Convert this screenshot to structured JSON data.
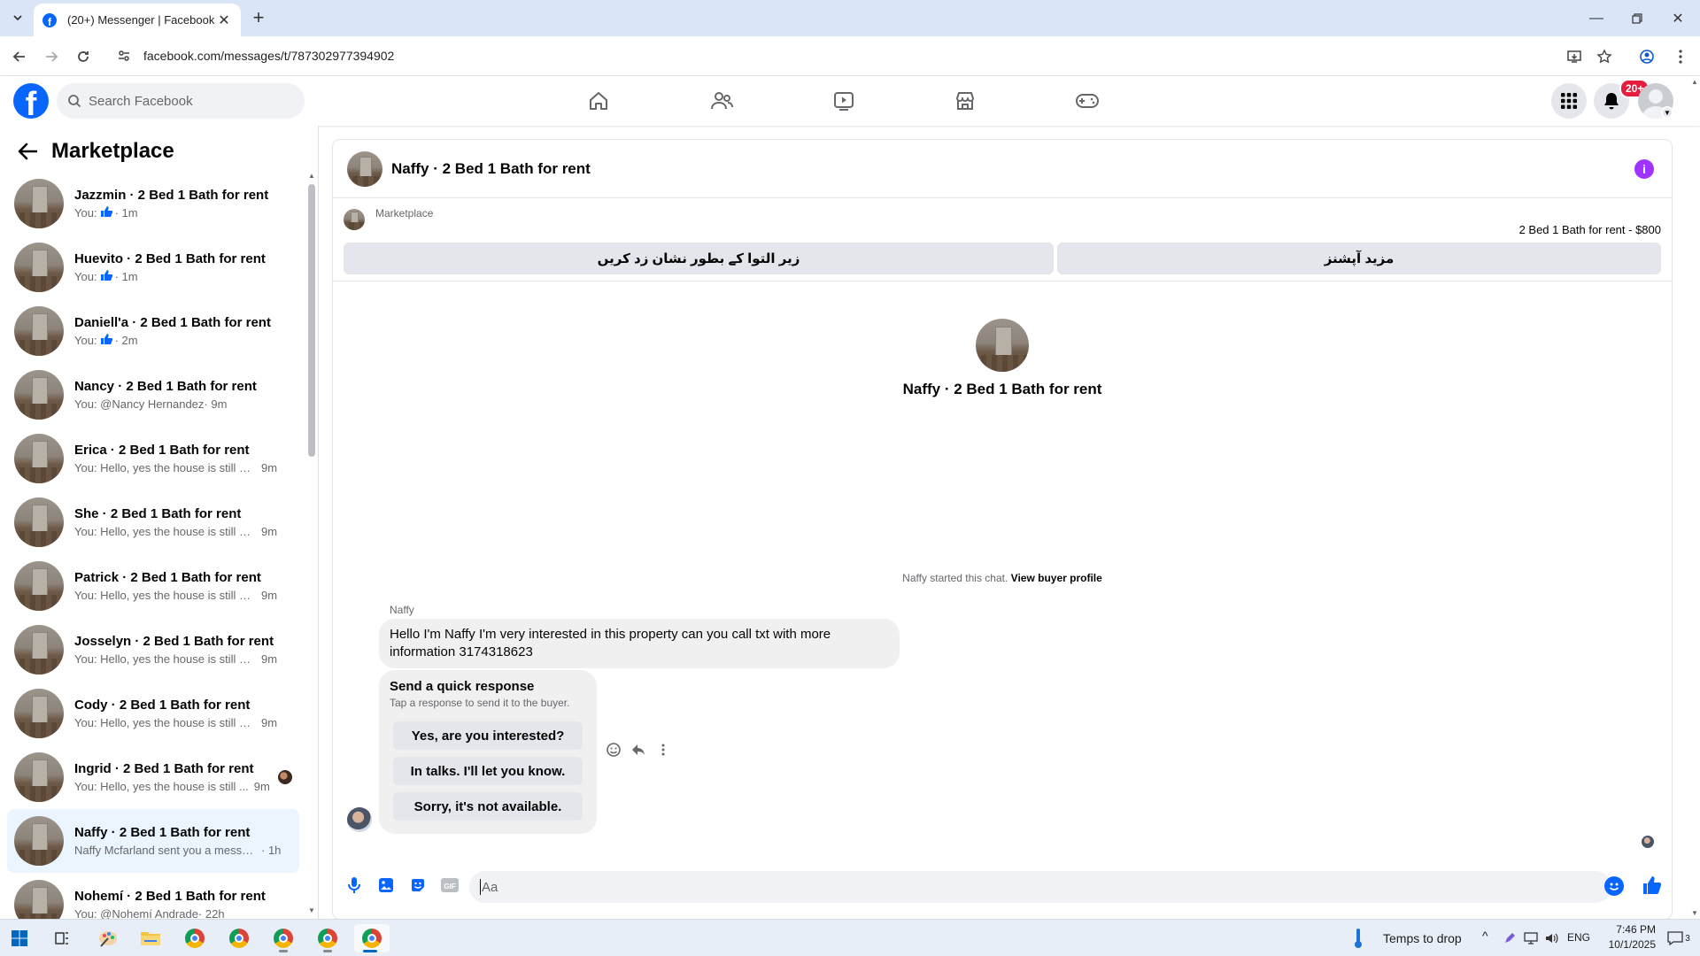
{
  "browser": {
    "tab_title": "(20+) Messenger | Facebook",
    "url": "facebook.com/messages/t/787302977394902"
  },
  "fb": {
    "search_placeholder": "Search Facebook",
    "notification_badge": "20+",
    "brand_color": "#0866ff"
  },
  "sidebar": {
    "title": "Marketplace",
    "chats": [
      {
        "name": "Jazzmin · 2 Bed 1 Bath for rent",
        "preview": "You:",
        "time": "· 1m",
        "like": true
      },
      {
        "name": "Huevito · 2 Bed 1 Bath for rent",
        "preview": "You:",
        "time": "· 1m",
        "like": true
      },
      {
        "name": "Daniell'a · 2 Bed 1 Bath for rent",
        "preview": "You:",
        "time": "· 2m",
        "like": true
      },
      {
        "name": "Nancy · 2 Bed 1 Bath for rent",
        "preview": "You: @Nancy Hernandez",
        "time": "· 9m"
      },
      {
        "name": "Erica · 2 Bed 1 Bath for rent",
        "preview": "You: Hello, yes the house is still av...",
        "time": "9m"
      },
      {
        "name": "She · 2 Bed 1 Bath for rent",
        "preview": "You: Hello, yes the house is still av...",
        "time": "9m"
      },
      {
        "name": "Patrick · 2 Bed 1 Bath for rent",
        "preview": "You: Hello, yes the house is still av...",
        "time": "9m"
      },
      {
        "name": "Josselyn · 2 Bed 1 Bath for rent",
        "preview": "You: Hello, yes the house is still av...",
        "time": "9m"
      },
      {
        "name": "Cody · 2 Bed 1 Bath for rent",
        "preview": "You: Hello, yes the house is still av...",
        "time": "9m"
      },
      {
        "name": "Ingrid · 2 Bed 1 Bath for rent",
        "preview": "You: Hello, yes the house is still ...",
        "time": "9m",
        "seen": true
      },
      {
        "name": "Naffy · 2 Bed 1 Bath for rent",
        "preview": "Naffy Mcfarland sent you a messag...",
        "time": "· 1h",
        "active": true
      },
      {
        "name": "Nohemí · 2 Bed 1 Bath for rent",
        "preview": "You: @Nohemí Andrade",
        "time": "· 22h"
      }
    ]
  },
  "conversation": {
    "title": "Naffy · 2 Bed 1 Bath for rent",
    "marketplace_label": "Marketplace",
    "listing_price": "2 Bed 1 Bath for rent - $800",
    "btn_mark_pending": "زیر التوا کے بطور نشان زد کریں",
    "btn_more_options": "مزید آپشنز",
    "center_title": "Naffy · 2 Bed 1 Bath for rent",
    "started_text": "Naffy started this chat.",
    "view_profile": "View buyer profile",
    "sender": "Naffy",
    "message": "Hello I'm Naffy I'm very interested in this property can you call txt with more information 3174318623",
    "quick": {
      "title": "Send a quick response",
      "subtitle": "Tap a response to send it to the buyer.",
      "options": [
        "Yes, are you interested?",
        "In talks. I'll let you know.",
        "Sorry, it's not available."
      ]
    },
    "composer_placeholder": "Aa"
  },
  "taskbar": {
    "weather": "Temps to drop",
    "lang": "ENG",
    "time": "7:46 PM",
    "date": "10/1/2025",
    "notif_count": "3"
  }
}
